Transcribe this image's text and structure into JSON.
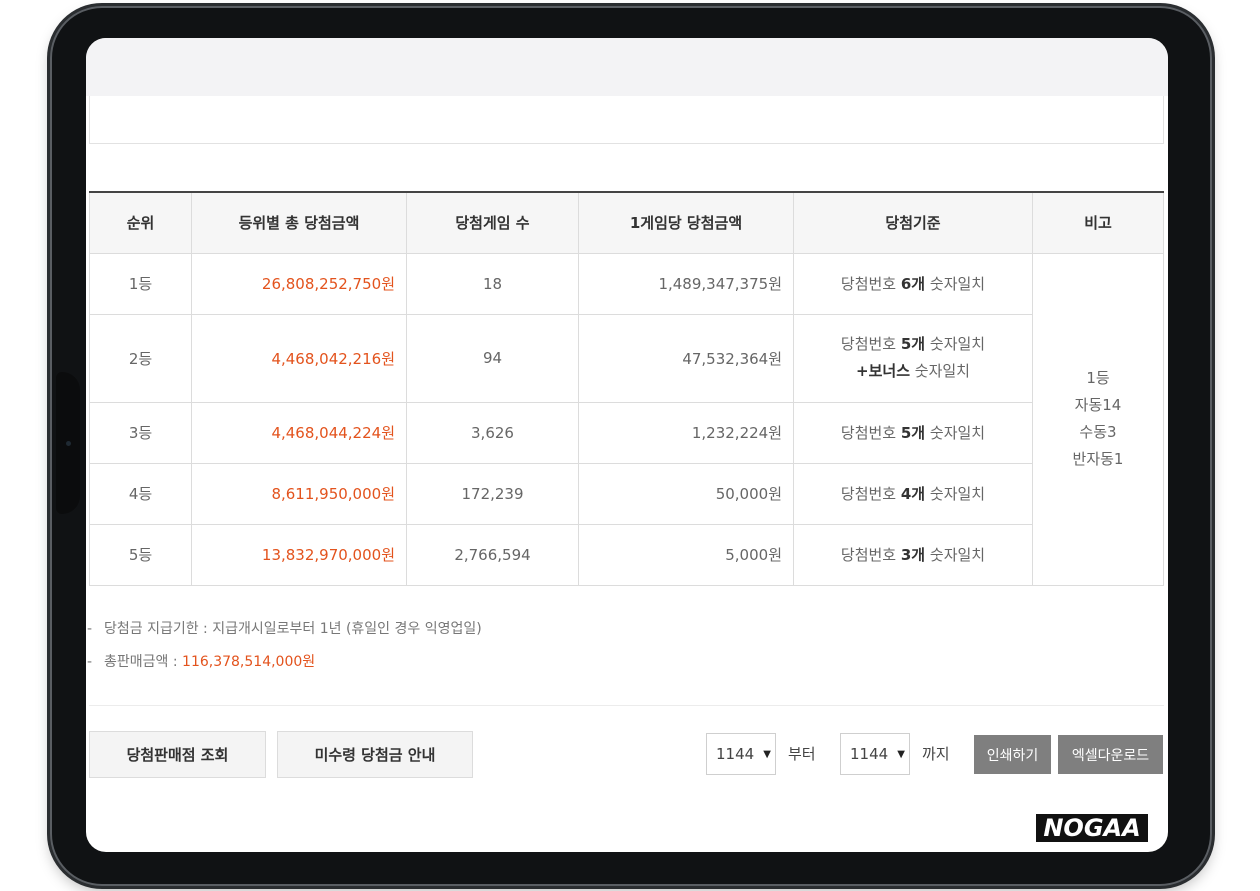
{
  "table": {
    "headers": [
      "순위",
      "등위별 총 당첨금액",
      "당첨게임 수",
      "1게임당 당첨금액",
      "당첨기준",
      "비고"
    ],
    "rows": [
      {
        "rank": "1등",
        "total": "26,808,252,750원",
        "games": "18",
        "per_game": "1,489,347,375원",
        "criteria_pre": "당첨번호 ",
        "criteria_count": "6개",
        "criteria_post": " 숫자일치",
        "bonus_bold": "",
        "bonus_post": ""
      },
      {
        "rank": "2등",
        "total": "4,468,042,216원",
        "games": "94",
        "per_game": "47,532,364원",
        "criteria_pre": "당첨번호 ",
        "criteria_count": "5개",
        "criteria_post": " 숫자일치",
        "bonus_bold": "+보너스",
        "bonus_post": " 숫자일치"
      },
      {
        "rank": "3등",
        "total": "4,468,044,224원",
        "games": "3,626",
        "per_game": "1,232,224원",
        "criteria_pre": "당첨번호 ",
        "criteria_count": "5개",
        "criteria_post": " 숫자일치",
        "bonus_bold": "",
        "bonus_post": ""
      },
      {
        "rank": "4등",
        "total": "8,611,950,000원",
        "games": "172,239",
        "per_game": "50,000원",
        "criteria_pre": "당첨번호 ",
        "criteria_count": "4개",
        "criteria_post": " 숫자일치",
        "bonus_bold": "",
        "bonus_post": ""
      },
      {
        "rank": "5등",
        "total": "13,832,970,000원",
        "games": "2,766,594",
        "per_game": "5,000원",
        "criteria_pre": "당첨번호 ",
        "criteria_count": "3개",
        "criteria_post": " 숫자일치",
        "bonus_bold": "",
        "bonus_post": ""
      }
    ],
    "note_lines": [
      "1등",
      "자동14",
      "수동3",
      "반자동1"
    ]
  },
  "notes": {
    "deadline": "당첨금 지급기한 : 지급개시일로부터 1년 (휴일인 경우 익영업일)",
    "sales_label": "총판매금액 : ",
    "sales_value": "116,378,514,000원"
  },
  "actions": {
    "store_lookup": "당첨판매점 조회",
    "unclaimed": "미수령 당첨금 안내",
    "from_round": "1144",
    "from_word": "부터",
    "to_round": "1144",
    "to_word": "까지",
    "print": "인쇄하기",
    "excel": "엑셀다운로드"
  },
  "watermark": "NOGAA",
  "colors": {
    "accent_red": "#e3531d",
    "header_bg": "#f6f6f6",
    "dark_button": "#7f7f7f"
  }
}
